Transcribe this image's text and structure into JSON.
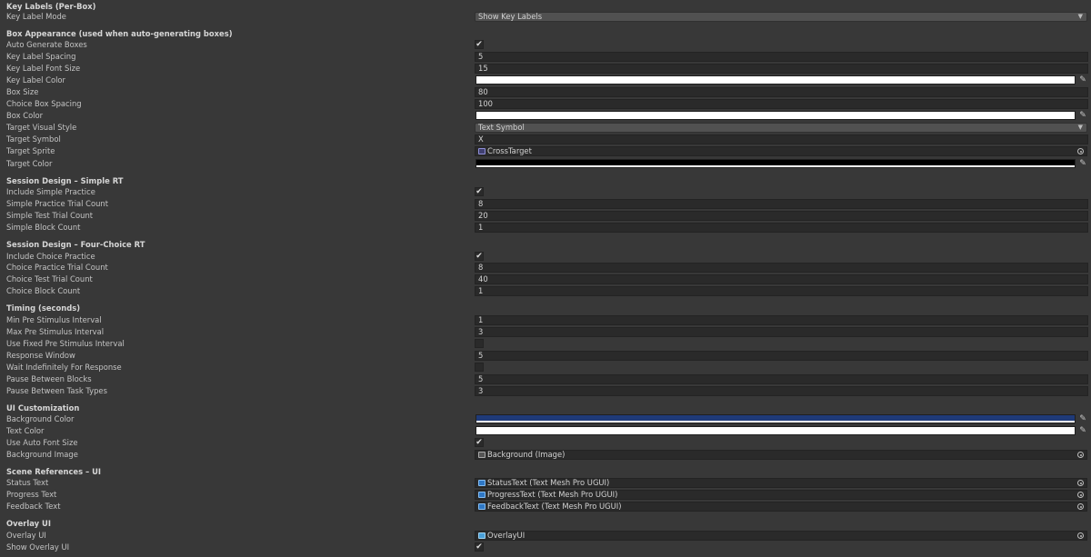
{
  "colors": {
    "background": "#383838",
    "field": "#2a2a2a",
    "target_color": "#000000",
    "background_color": "#1f3a78",
    "white": "#ffffff"
  },
  "rows": [
    {
      "kind": "header",
      "label": "Key Labels (Per-Box)"
    },
    {
      "kind": "dropdown",
      "label": "Key Label Mode",
      "value": "Show Key Labels"
    },
    {
      "kind": "header",
      "label": "Box Appearance (used when auto-generating boxes)"
    },
    {
      "kind": "toggle",
      "label": "Auto Generate Boxes",
      "checked": true
    },
    {
      "kind": "text",
      "label": "Key Label Spacing",
      "value": "5"
    },
    {
      "kind": "text",
      "label": "Key Label Font Size",
      "value": "15"
    },
    {
      "kind": "color",
      "label": "Key Label Color",
      "color": "#ffffff"
    },
    {
      "kind": "text",
      "label": "Box Size",
      "value": "80"
    },
    {
      "kind": "text",
      "label": "Choice Box Spacing",
      "value": "100"
    },
    {
      "kind": "color",
      "label": "Box Color",
      "color": "#ffffff"
    },
    {
      "kind": "dropdown",
      "label": "Target Visual Style",
      "value": "Text Symbol"
    },
    {
      "kind": "text",
      "label": "Target Symbol",
      "value": "X"
    },
    {
      "kind": "object",
      "label": "Target Sprite",
      "value": "CrossTarget",
      "icon": "sprite-icon"
    },
    {
      "kind": "color",
      "label": "Target Color",
      "color": "#000000"
    },
    {
      "kind": "header",
      "label": "Session Design – Simple RT"
    },
    {
      "kind": "toggle",
      "label": "Include Simple Practice",
      "checked": true
    },
    {
      "kind": "text",
      "label": "Simple Practice Trial Count",
      "value": "8"
    },
    {
      "kind": "text",
      "label": "Simple Test Trial Count",
      "value": "20"
    },
    {
      "kind": "text",
      "label": "Simple Block Count",
      "value": "1"
    },
    {
      "kind": "header",
      "label": "Session Design – Four-Choice RT"
    },
    {
      "kind": "toggle",
      "label": "Include Choice Practice",
      "checked": true
    },
    {
      "kind": "text",
      "label": "Choice Practice Trial Count",
      "value": "8"
    },
    {
      "kind": "text",
      "label": "Choice Test Trial Count",
      "value": "40"
    },
    {
      "kind": "text",
      "label": "Choice Block Count",
      "value": "1"
    },
    {
      "kind": "header",
      "label": "Timing (seconds)"
    },
    {
      "kind": "text",
      "label": "Min Pre Stimulus Interval",
      "value": "1"
    },
    {
      "kind": "text",
      "label": "Max Pre Stimulus Interval",
      "value": "3"
    },
    {
      "kind": "toggle",
      "label": "Use Fixed Pre Stimulus Interval",
      "checked": false
    },
    {
      "kind": "text",
      "label": "Response Window",
      "value": "5"
    },
    {
      "kind": "toggle",
      "label": "Wait Indefinitely For Response",
      "checked": false
    },
    {
      "kind": "text",
      "label": "Pause Between Blocks",
      "value": "5"
    },
    {
      "kind": "text",
      "label": "Pause Between Task Types",
      "value": "3"
    },
    {
      "kind": "header",
      "label": "UI Customization"
    },
    {
      "kind": "color",
      "label": "Background Color",
      "color": "#1f3a78"
    },
    {
      "kind": "color",
      "label": "Text Color",
      "color": "#ffffff"
    },
    {
      "kind": "toggle",
      "label": "Use Auto Font Size",
      "checked": true
    },
    {
      "kind": "object",
      "label": "Background Image",
      "value": "Background (Image)",
      "icon": "image-icon"
    },
    {
      "kind": "header",
      "label": "Scene References – UI"
    },
    {
      "kind": "object",
      "label": "Status Text",
      "value": "StatusText (Text Mesh Pro UGUI)",
      "icon": "text-mesh-pro-icon"
    },
    {
      "kind": "object",
      "label": "Progress Text",
      "value": "ProgressText (Text Mesh Pro UGUI)",
      "icon": "text-mesh-pro-icon"
    },
    {
      "kind": "object",
      "label": "Feedback Text",
      "value": "FeedbackText (Text Mesh Pro UGUI)",
      "icon": "text-mesh-pro-icon"
    },
    {
      "kind": "header",
      "label": "Overlay UI"
    },
    {
      "kind": "object",
      "label": "Overlay UI",
      "value": "OverlayUI",
      "icon": "gameobject-icon"
    },
    {
      "kind": "toggle",
      "label": "Show Overlay UI",
      "checked": true
    }
  ]
}
